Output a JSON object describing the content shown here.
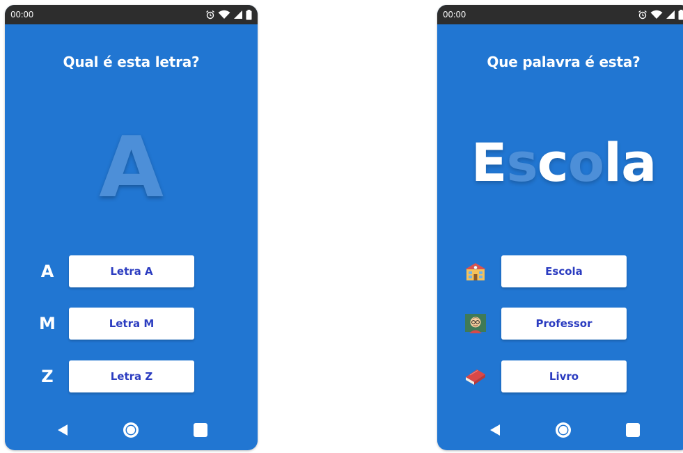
{
  "colors": {
    "screen_bg": "#2176d2",
    "status_bar_bg": "#2d2d2d",
    "button_text": "#2b3cc0",
    "faded_letter": "#4d8fd8",
    "white": "#ffffff"
  },
  "left_screen": {
    "status": {
      "time": "00:00",
      "icons": [
        "alarm-icon",
        "wifi-icon",
        "signal-icon",
        "battery-icon"
      ]
    },
    "question": "Qual é esta letra?",
    "big_letter": "A",
    "options": [
      {
        "label": "A",
        "button": "Letra A"
      },
      {
        "label": "M",
        "button": "Letra M"
      },
      {
        "label": "Z",
        "button": "Letra Z"
      }
    ],
    "nav": [
      "back-icon",
      "home-icon",
      "recents-icon"
    ]
  },
  "right_screen": {
    "status": {
      "time": "00:00",
      "icons": [
        "alarm-icon",
        "wifi-icon",
        "signal-icon",
        "battery-icon"
      ]
    },
    "question": "Que palavra é esta?",
    "big_word": {
      "letters": [
        "E",
        "s",
        "c",
        "o",
        "l",
        "a"
      ],
      "faded": [
        false,
        true,
        false,
        true,
        false,
        false
      ]
    },
    "options": [
      {
        "icon": "school-emoji-icon",
        "button": "Escola"
      },
      {
        "icon": "teacher-emoji-icon",
        "button": "Professor"
      },
      {
        "icon": "book-emoji-icon",
        "button": "Livro"
      }
    ],
    "nav": [
      "back-icon",
      "home-icon",
      "recents-icon"
    ]
  }
}
